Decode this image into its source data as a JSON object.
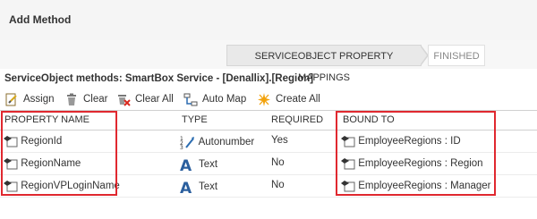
{
  "header": {
    "title": "Add Method"
  },
  "wizard": {
    "steps": [
      {
        "label": "SERVICEOBJECT PROPERTY MAPPINGS"
      },
      {
        "label": "FINISHED"
      }
    ]
  },
  "methods_title": "ServiceObject methods: SmartBox Service - [Denallix].[Region]",
  "toolbar": {
    "assign": "Assign",
    "clear": "Clear",
    "clear_all": "Clear All",
    "auto_map": "Auto Map",
    "create_all": "Create All"
  },
  "columns": {
    "property_name": "PROPERTY NAME",
    "type": "TYPE",
    "required": "REQUIRED",
    "bound_to": "BOUND TO"
  },
  "rows": [
    {
      "name": "RegionId",
      "type": "Autonumber",
      "type_icon": "autonumber-icon",
      "required": "Yes",
      "bound": "EmployeeRegions : ID"
    },
    {
      "name": "RegionName",
      "type": "Text",
      "type_icon": "text-type-icon",
      "required": "No",
      "bound": "EmployeeRegions : Region"
    },
    {
      "name": "RegionVPLoginName",
      "type": "Text",
      "type_icon": "text-type-icon",
      "required": "No",
      "bound": "EmployeeRegions : Manager"
    }
  ],
  "colors": {
    "highlight": "#e0282f",
    "text_type": "#2b5f9e"
  }
}
